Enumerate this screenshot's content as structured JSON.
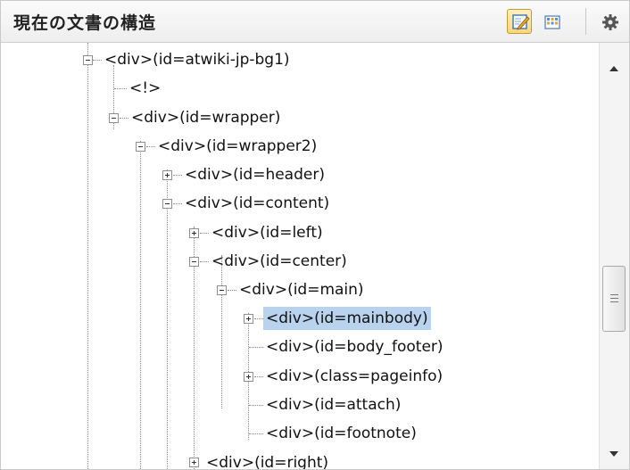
{
  "panel": {
    "title": "現在の文書の構造",
    "toolbar": [
      {
        "icon": "edit-view-icon",
        "active": true
      },
      {
        "icon": "grid-view-icon",
        "active": false
      },
      {
        "icon": "gear-icon",
        "active": false
      }
    ]
  },
  "tree": {
    "nodes": [
      {
        "label": "<div>(id=atwiki-jp-bg1)",
        "expander": "minus"
      },
      {
        "label": "<!>",
        "expander": "none"
      },
      {
        "label": "<div>(id=wrapper)",
        "expander": "minus"
      },
      {
        "label": "<div>(id=wrapper2)",
        "expander": "minus"
      },
      {
        "label": "<div>(id=header)",
        "expander": "plus"
      },
      {
        "label": "<div>(id=content)",
        "expander": "minus"
      },
      {
        "label": "<div>(id=left)",
        "expander": "plus"
      },
      {
        "label": "<div>(id=center)",
        "expander": "minus"
      },
      {
        "label": "<div>(id=main)",
        "expander": "minus"
      },
      {
        "label": "<div>(id=mainbody)",
        "expander": "plus",
        "selected": true
      },
      {
        "label": "<div>(id=body_footer)",
        "expander": "none"
      },
      {
        "label": "<div>(class=pageinfo)",
        "expander": "plus"
      },
      {
        "label": "<div>(id=attach)",
        "expander": "none"
      },
      {
        "label": "<div>(id=footnote)",
        "expander": "none"
      },
      {
        "label": "<div>(id=right)",
        "expander": "plus"
      }
    ]
  },
  "colors": {
    "selection": "#b9d3ee",
    "active_button": "#f9d77e"
  }
}
